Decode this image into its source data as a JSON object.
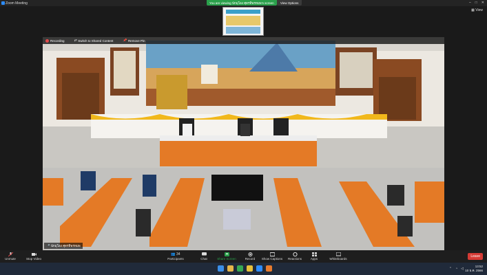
{
  "window": {
    "title": "Zoom Meeting",
    "view_label": "View",
    "controls": [
      "–",
      "□",
      "✕"
    ]
  },
  "share_banner": {
    "text": "You are viewing นักมุโอง ศุดรทิพรหมพ’s screen",
    "view_options": "View Options"
  },
  "video": {
    "top_bar": {
      "recording": "Recording",
      "switch_speaker": "Switch to Shared Content",
      "remove_pin": "Remove Pin"
    },
    "participant_name": "นักมุโอง ศุดรทิพรหมพ"
  },
  "toolbar": {
    "unmute": "Unmute",
    "stop_video": "Stop Video",
    "participants": "Participants",
    "participant_count": "34",
    "chat": "Chat",
    "share_screen": "Share Screen",
    "record": "Record",
    "show_captions": "Show Captions",
    "reactions": "Reactions",
    "apps": "Apps",
    "whiteboards": "Whiteboards",
    "leave": "Leave"
  },
  "taskbar": {
    "time": "13:52",
    "date": "10 ธ.ค. 2566"
  },
  "colors": {
    "share_green": "#2aa04b",
    "leave_red": "#d53b35",
    "zoom_blue": "#2d8cff"
  }
}
